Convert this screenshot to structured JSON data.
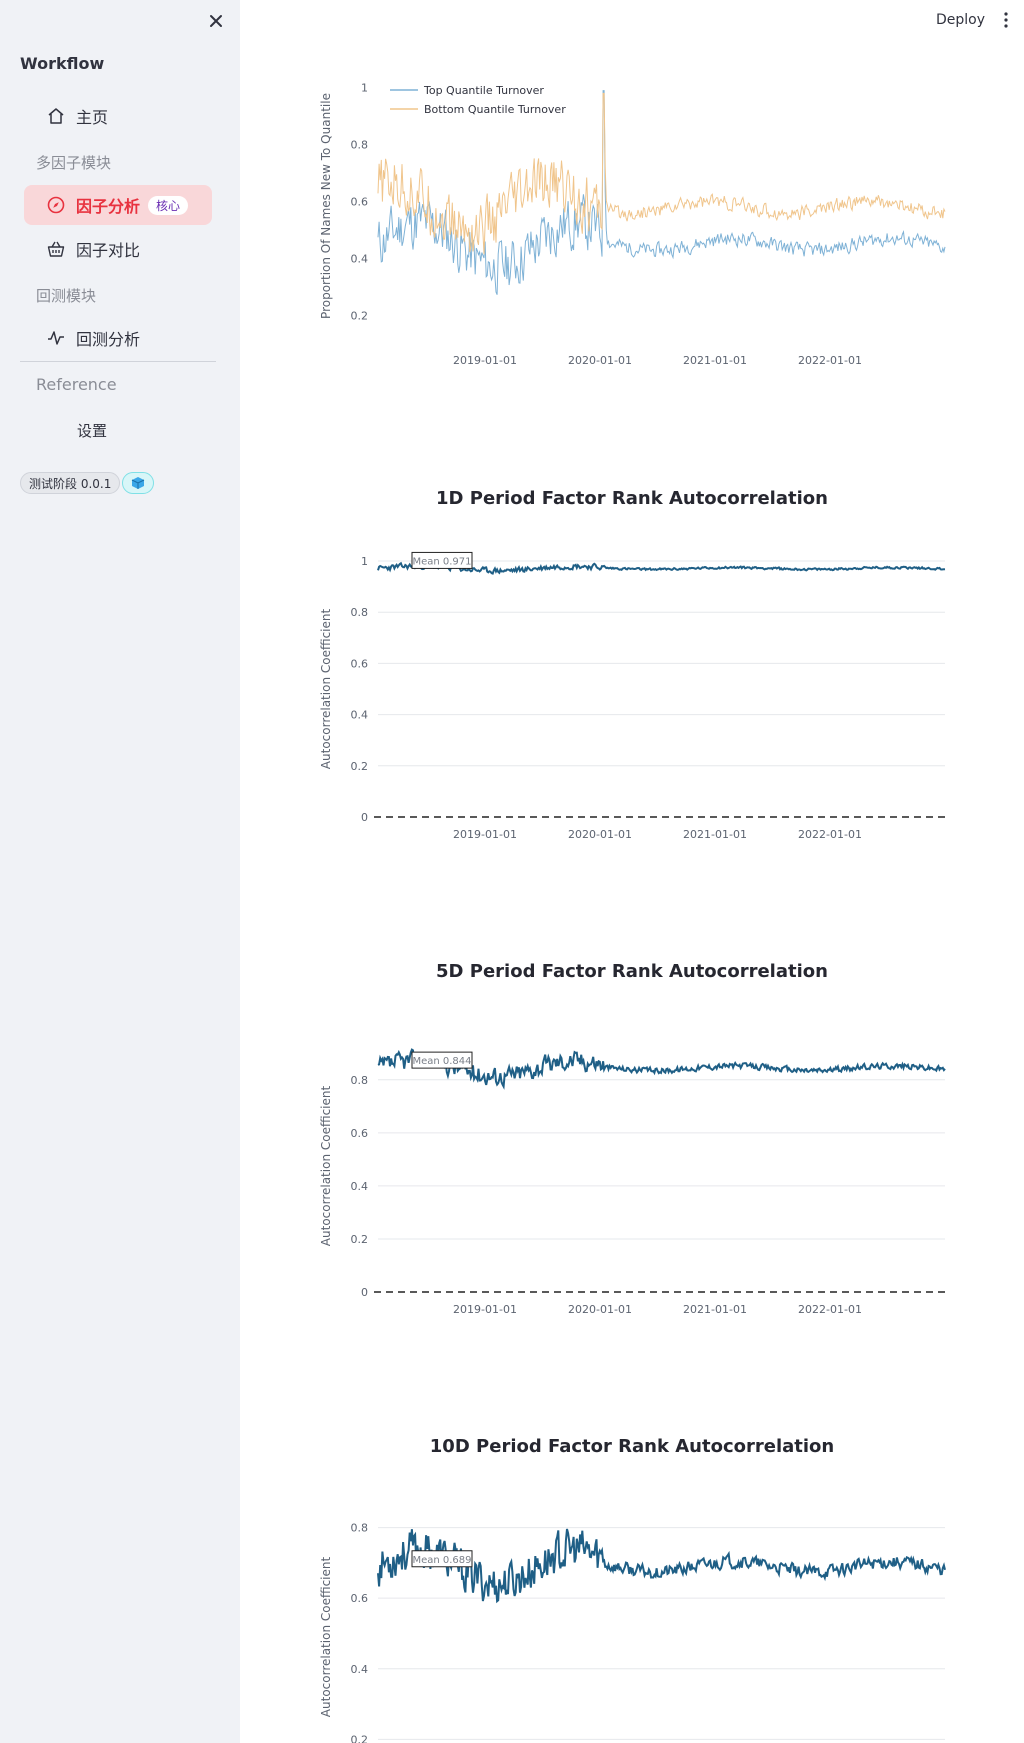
{
  "sidebar": {
    "title": "Workflow",
    "close_icon": "close-icon",
    "items": [
      {
        "label": "主页",
        "icon": "home-icon"
      },
      {
        "label": "因子分析",
        "icon": "compass-icon",
        "badge": "核心",
        "active": true
      },
      {
        "label": "因子对比",
        "icon": "basket-icon"
      },
      {
        "label": "回测分析",
        "icon": "pulse-icon"
      }
    ],
    "sections": [
      "多因子模块",
      "回测模块"
    ],
    "reference": "Reference",
    "settings": "设置",
    "version": "测试阶段 0.0.1",
    "accent": "#e8323f"
  },
  "header": {
    "deploy": "Deploy"
  },
  "chart_data": [
    {
      "type": "line",
      "title": "",
      "ylabel": "Proportion Of Names New To Quantile",
      "yticks": [
        "1",
        "0.8",
        "0.6",
        "0.4",
        "0.2"
      ],
      "xticks": [
        "2019-01-01",
        "2020-01-01",
        "2021-01-01",
        "2022-01-01"
      ],
      "ylim": [
        0.15,
        1.02
      ],
      "x_range": [
        "2018-02-01",
        "2022-12-30"
      ],
      "series": [
        {
          "name": "Top Quantile Turnover",
          "color": "#7fb2d6",
          "mean": 0.45,
          "noise_early": 0.13,
          "noise_late": 0.035,
          "spike": 0.99
        },
        {
          "name": "Bottom Quantile Turnover",
          "color": "#f0c58c",
          "mean": 0.58,
          "noise_early": 0.14,
          "noise_late": 0.035,
          "spike": 0.98
        }
      ],
      "legend": "top-left",
      "grid": false
    },
    {
      "type": "line",
      "title": "1D Period Factor Rank Autocorrelation",
      "ylabel": "Autocorrelation Coefficient",
      "yticks": [
        "1",
        "0.8",
        "0.6",
        "0.4",
        "0.2",
        "0"
      ],
      "xticks": [
        "2019-01-01",
        "2020-01-01",
        "2021-01-01",
        "2022-01-01"
      ],
      "ylim": [
        0,
        1
      ],
      "annotation": "Mean 0.971",
      "series": [
        {
          "name": "",
          "color": "#1f5f86",
          "mean": 0.971,
          "noise_early": 0.015,
          "noise_late": 0.006
        }
      ],
      "zero_line": "dashed",
      "grid": true
    },
    {
      "type": "line",
      "title": "5D Period Factor Rank Autocorrelation",
      "ylabel": "Autocorrelation Coefficient",
      "yticks": [
        "0.8",
        "0.6",
        "0.4",
        "0.2",
        "0"
      ],
      "xticks": [
        "2019-01-01",
        "2020-01-01",
        "2021-01-01",
        "2022-01-01"
      ],
      "ylim": [
        0,
        0.95
      ],
      "annotation": "Mean 0.844",
      "series": [
        {
          "name": "",
          "color": "#1f5f86",
          "mean": 0.844,
          "noise_early": 0.05,
          "noise_late": 0.015
        }
      ],
      "zero_line": "dashed",
      "grid": true
    },
    {
      "type": "line",
      "title": "10D Period Factor Rank Autocorrelation",
      "ylabel": "Autocorrelation Coefficient",
      "yticks": [
        "0.8",
        "0.6",
        "0.4",
        "0.2"
      ],
      "xticks": [],
      "ylim": [
        0.15,
        0.83
      ],
      "annotation": "Mean 0.689",
      "series": [
        {
          "name": "",
          "color": "#1f5f86",
          "mean": 0.689,
          "noise_early": 0.08,
          "noise_late": 0.025
        }
      ],
      "grid": true
    }
  ]
}
